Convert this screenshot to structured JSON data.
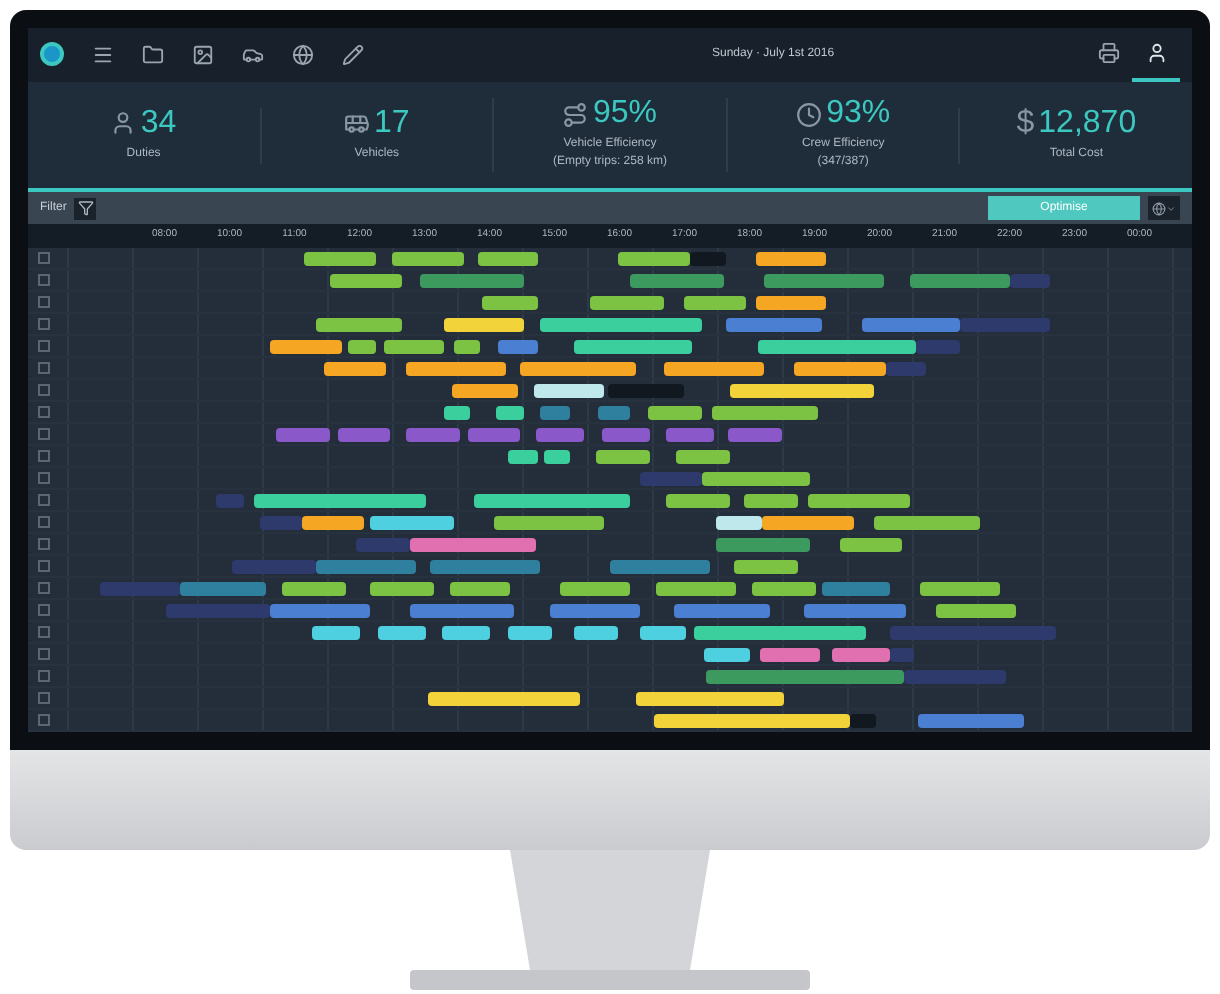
{
  "toolbar": {
    "date": "Sunday · July 1st 2016",
    "tabs": [
      {
        "selected": false
      },
      {
        "selected": true
      }
    ]
  },
  "kpis": [
    {
      "value": "34",
      "label": "Duties"
    },
    {
      "value": "17",
      "label": "Vehicles"
    },
    {
      "value": "95%",
      "label": "Vehicle Efficiency",
      "detail": "(Empty trips: 258 km)"
    },
    {
      "value": "93%",
      "label": "Crew Efficiency",
      "detail": "(347/387)"
    },
    {
      "prefix": "$",
      "value": "12,870",
      "label": "Total Cost"
    }
  ],
  "filter_bar": {
    "label": "Filter",
    "button": "Optimise"
  },
  "timeline": {
    "hours": [
      "08:00",
      "10:00",
      "11:00",
      "12:00",
      "13:00",
      "14:00",
      "15:00",
      "16:00",
      "17:00",
      "18:00",
      "19:00",
      "20:00",
      "21:00",
      "22:00",
      "23:00",
      "00:00"
    ]
  },
  "rows": [
    {
      "checked": false
    },
    {
      "checked": false
    },
    {
      "checked": false
    },
    {
      "checked": false
    },
    {
      "checked": false
    },
    {
      "checked": false
    },
    {
      "checked": false
    },
    {
      "checked": false
    },
    {
      "checked": false
    },
    {
      "checked": false
    },
    {
      "checked": false
    },
    {
      "checked": false
    },
    {
      "checked": false
    },
    {
      "checked": false
    },
    {
      "checked": false
    },
    {
      "checked": false
    },
    {
      "checked": false
    },
    {
      "checked": false
    },
    {
      "checked": false
    },
    {
      "checked": false
    },
    {
      "checked": false
    },
    {
      "checked": false
    }
  ]
}
